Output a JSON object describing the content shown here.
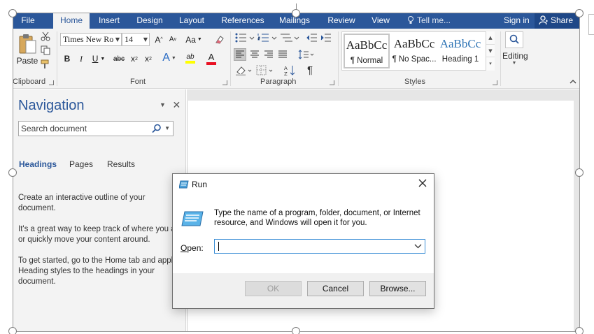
{
  "tabs": [
    {
      "label": "File",
      "active": false
    },
    {
      "label": "Home",
      "active": true
    },
    {
      "label": "Insert",
      "active": false
    },
    {
      "label": "Design",
      "active": false
    },
    {
      "label": "Layout",
      "active": false
    },
    {
      "label": "References",
      "active": false
    },
    {
      "label": "Mailings",
      "active": false
    },
    {
      "label": "Review",
      "active": false
    },
    {
      "label": "View",
      "active": false
    }
  ],
  "tell_me": "Tell me...",
  "sign_in": "Sign in",
  "share": "Share",
  "ribbon": {
    "clipboard": {
      "label": "Clipboard",
      "paste": "Paste"
    },
    "font": {
      "label": "Font",
      "name": "Times New Ro",
      "size": "14",
      "grow": "A",
      "shrink": "A",
      "case": "Aa",
      "bold": "B",
      "italic": "I",
      "underline": "U",
      "strike": "abc",
      "subscript": "x",
      "superscript": "x",
      "effects": "A",
      "highlight": "ab",
      "color": "A"
    },
    "paragraph": {
      "label": "Paragraph",
      "pilcrow": "¶"
    },
    "styles": {
      "label": "Styles",
      "items": [
        {
          "sample": "AaBbCc",
          "name": "¶ Normal",
          "selected": true
        },
        {
          "sample": "AaBbCc",
          "name": "¶ No Spac...",
          "selected": false
        },
        {
          "sample": "AaBbCc",
          "name": "Heading 1",
          "selected": false
        }
      ]
    },
    "editing": {
      "label": "Editing"
    }
  },
  "navigation": {
    "title": "Navigation",
    "search_placeholder": "Search document",
    "tabs": [
      "Headings",
      "Pages",
      "Results"
    ],
    "lines": [
      "Create an interactive outline of your",
      "document.",
      "It's a great way to keep track of where you ar",
      "or quickly move your content around.",
      "To get started, go to the Home tab and apply",
      "Heading styles to the headings in your",
      "document."
    ]
  },
  "run_dialog": {
    "title": "Run",
    "description": "Type the name of a program, folder, document, or Internet resource, and Windows will open it for you.",
    "open_label": "Open:",
    "open_value": "",
    "ok": "OK",
    "cancel": "Cancel",
    "browse": "Browse..."
  },
  "colors": {
    "word_blue": "#2b579a",
    "share_bg": "#1e4787",
    "ribbon_bg": "#f3f3f3",
    "input_focus": "#3d8fd6",
    "highlight_yellow": "#ffff00",
    "font_red": "#e81123"
  }
}
